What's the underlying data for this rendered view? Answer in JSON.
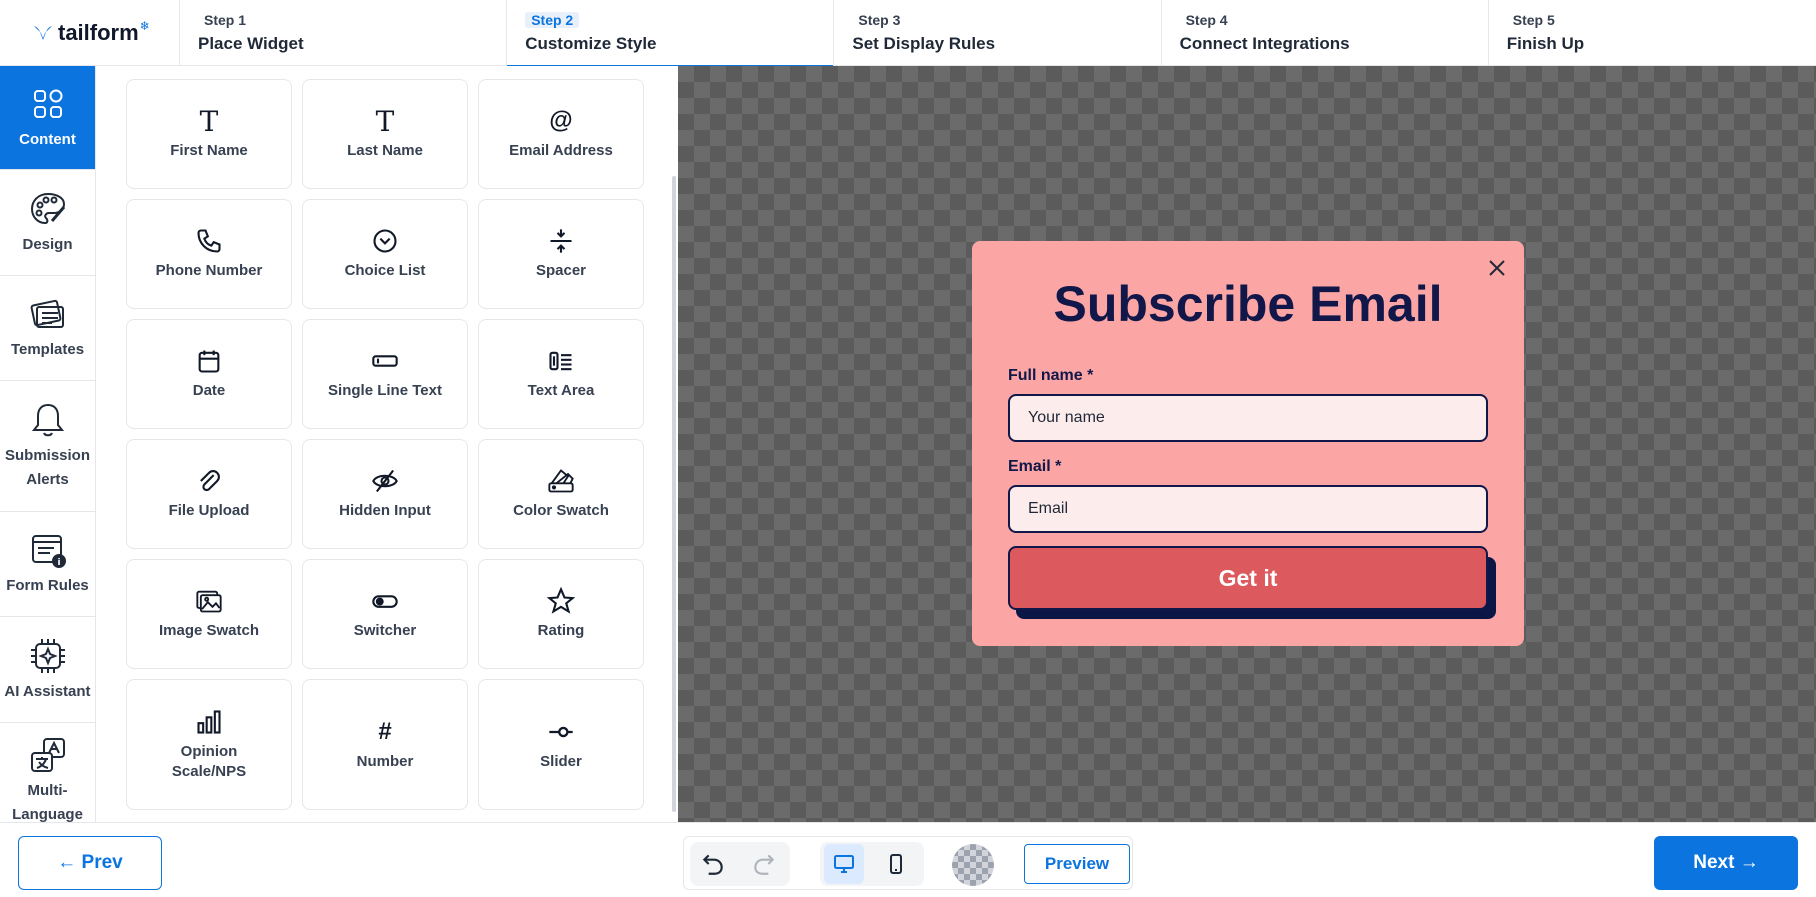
{
  "brand": {
    "name": "tailform",
    "accent": "#0b74de"
  },
  "steps": [
    {
      "num": "Step 1",
      "title": "Place Widget",
      "active": false
    },
    {
      "num": "Step 2",
      "title": "Customize Style",
      "active": true
    },
    {
      "num": "Step 3",
      "title": "Set Display Rules",
      "active": false
    },
    {
      "num": "Step 4",
      "title": "Connect Integrations",
      "active": false
    },
    {
      "num": "Step 5",
      "title": "Finish Up",
      "active": false
    }
  ],
  "sidebar": {
    "items": [
      {
        "label": "Content",
        "icon": "grid-icon",
        "active": true
      },
      {
        "label": "Design",
        "icon": "palette-icon",
        "active": false
      },
      {
        "label": "Templates",
        "icon": "templates-icon",
        "active": false
      },
      {
        "label": "Submission Alerts",
        "icon": "bell-icon",
        "active": false
      },
      {
        "label": "Form Rules",
        "icon": "form-rules-icon",
        "active": false
      },
      {
        "label": "AI Assistant",
        "icon": "ai-chip-icon",
        "active": false
      },
      {
        "label": "Multi-Language",
        "icon": "translate-icon",
        "active": false
      }
    ]
  },
  "widgets": [
    {
      "label": "First Name",
      "icon": "text-t-icon"
    },
    {
      "label": "Last Name",
      "icon": "text-t-icon"
    },
    {
      "label": "Email Address",
      "icon": "at-icon"
    },
    {
      "label": "Phone Number",
      "icon": "phone-icon"
    },
    {
      "label": "Choice List",
      "icon": "chevron-circle-icon"
    },
    {
      "label": "Spacer",
      "icon": "spacer-icon"
    },
    {
      "label": "Date",
      "icon": "calendar-icon"
    },
    {
      "label": "Single Line Text",
      "icon": "single-line-icon"
    },
    {
      "label": "Text Area",
      "icon": "text-area-icon"
    },
    {
      "label": "File Upload",
      "icon": "paperclip-icon"
    },
    {
      "label": "Hidden Input",
      "icon": "eye-off-icon"
    },
    {
      "label": "Color Swatch",
      "icon": "color-swatch-icon"
    },
    {
      "label": "Image Swatch",
      "icon": "image-swatch-icon"
    },
    {
      "label": "Switcher",
      "icon": "toggle-icon"
    },
    {
      "label": "Rating",
      "icon": "star-icon"
    },
    {
      "label": "Opinion Scale/NPS",
      "icon": "bar-chart-icon"
    },
    {
      "label": "Number",
      "icon": "hash-icon"
    },
    {
      "label": "Slider",
      "icon": "slider-icon"
    }
  ],
  "popup": {
    "title": "Subscribe Email",
    "fields": [
      {
        "label": "Full name *",
        "placeholder": "Your name"
      },
      {
        "label": "Email *",
        "placeholder": "Email"
      }
    ],
    "cta": "Get it",
    "colors": {
      "background": "#fca5a5",
      "title": "#111849",
      "button": "#dc5a5e"
    }
  },
  "bottom": {
    "prev": "← Prev",
    "next": "Next →",
    "preview": "Preview"
  }
}
